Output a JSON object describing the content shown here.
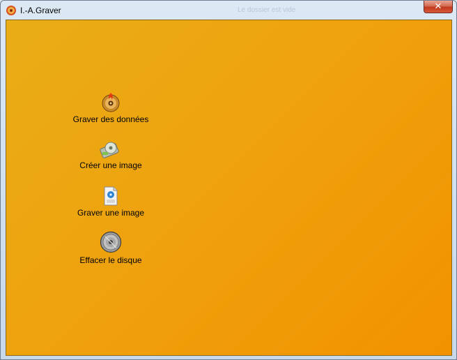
{
  "window": {
    "title": "I.-A.Graver",
    "ghost_text": "Le dossier est vide",
    "close_glyph": "✕"
  },
  "actions": [
    {
      "label": "Graver des données",
      "icon": "burn-disc-icon"
    },
    {
      "label": "Créer une image",
      "icon": "create-image-icon"
    },
    {
      "label": "Graver une image",
      "icon": "iso-file-icon"
    },
    {
      "label": "Effacer le disque",
      "icon": "erase-disc-icon"
    }
  ],
  "colors": {
    "background_start": "#e9ad17",
    "background_end": "#f29200",
    "close_button": "#c0391f"
  }
}
